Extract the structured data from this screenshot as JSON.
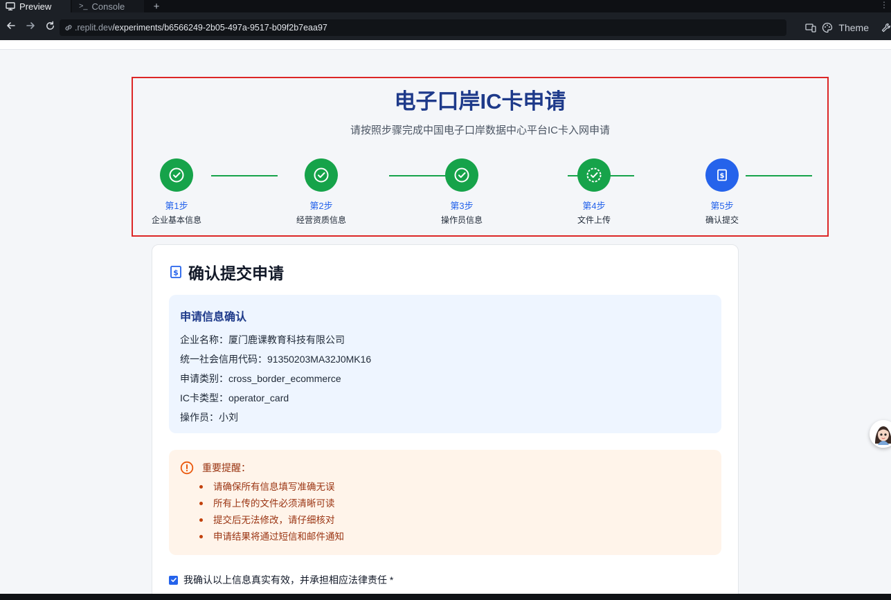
{
  "browser": {
    "tabs": [
      {
        "label": "Preview",
        "icon": "monitor-icon"
      },
      {
        "label": "Console",
        "icon": "terminal-icon"
      }
    ],
    "url_prefix": ".replit.dev",
    "url_path": "/experiments/b6566249-2b05-497a-9517-b09f2b7eaa97",
    "theme_label": "Theme"
  },
  "header": {
    "title": "电子口岸IC卡申请",
    "subtitle": "请按照步骤完成中国电子口岸数据中心平台IC卡入网申请"
  },
  "steps": [
    {
      "num": "第1步",
      "name": "企业基本信息",
      "status": "done"
    },
    {
      "num": "第2步",
      "name": "经营资质信息",
      "status": "done"
    },
    {
      "num": "第3步",
      "name": "操作员信息",
      "status": "done"
    },
    {
      "num": "第4步",
      "name": "文件上传",
      "status": "done"
    },
    {
      "num": "第5步",
      "name": "确认提交",
      "status": "active"
    }
  ],
  "card": {
    "title": "确认提交申请",
    "info": {
      "title": "申请信息确认",
      "rows": [
        "企业名称：厦门鹿课教育科技有限公司",
        "统一社会信用代码：91350203MA32J0MK16",
        "申请类别：cross_border_ecommerce",
        "IC卡类型：operator_card",
        "操作员：小刘"
      ]
    },
    "warning": {
      "title": "重要提醒：",
      "items": [
        "请确保所有信息填写准确无误",
        "所有上传的文件必须清晰可读",
        "提交后无法修改，请仔细核对",
        "申请结果将通过短信和邮件通知"
      ]
    },
    "agreement": {
      "label": "我确认以上信息真实有效，并承担相应法律责任 *",
      "checked": true
    }
  },
  "colors": {
    "done": "#16a34a",
    "active": "#2563eb",
    "title": "#1e3a8a",
    "highlight_border": "#dc2626",
    "warning_text": "#9a3412"
  }
}
